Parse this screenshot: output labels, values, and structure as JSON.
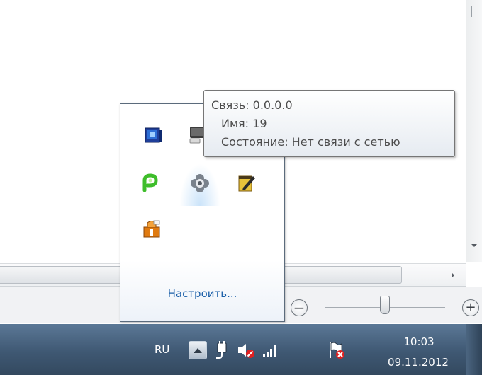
{
  "tooltip": {
    "line1": "Связь: 0.0.0.0",
    "line2": "Имя: 19",
    "line3": "Состояние: Нет связи с сетью"
  },
  "tray_popup": {
    "customize_label": "Настроить...",
    "icons": [
      "vpn-app-icon",
      "network-monitor-icon",
      "green-p-app-icon",
      "gray-flower-app-icon",
      "notepad-pen-icon",
      "orange-shield-app-icon"
    ]
  },
  "zoom": {
    "out_label": "−",
    "in_label": "+",
    "level": 0.5
  },
  "taskbar": {
    "language": "RU",
    "show_hidden_icons": "chevron-up-icon",
    "tray_icons": [
      "power-plug-icon",
      "volume-muted-icon",
      "signal-bars-icon",
      "action-center-flag-icon"
    ],
    "time": "10:03",
    "date": "09.11.2012"
  },
  "colors": {
    "taskbar": "#3f5873",
    "link": "#1a5ea8",
    "tooltip_text": "#4c4c4c"
  }
}
